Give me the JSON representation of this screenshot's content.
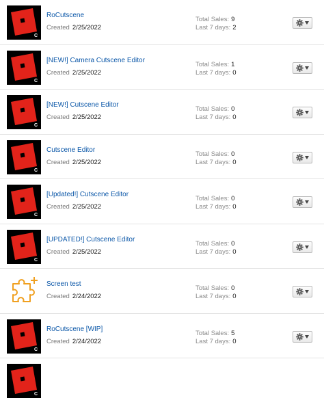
{
  "labels": {
    "created": "Created",
    "total_sales": "Total Sales:",
    "last_7_days": "Last 7 days:"
  },
  "icons": {
    "thumbnail": "roblox-studio-logo-icon",
    "plugin": "puzzle-piece-plus-icon",
    "settings": "gear-icon",
    "dropdown": "caret-down-icon"
  },
  "colors": {
    "title_link": "#0b57a8",
    "roblox_red": "#e2231a",
    "plugin_orange": "#f0a020"
  },
  "items": [
    {
      "title": "RoCutscene",
      "created": "2/25/2022",
      "total_sales": "9",
      "last_7_days": "2"
    },
    {
      "title": "[NEW!] Camera Cutscene Editor",
      "created": "2/25/2022",
      "total_sales": "1",
      "last_7_days": "0"
    },
    {
      "title": "[NEW!] Cutscene Editor",
      "created": "2/25/2022",
      "total_sales": "0",
      "last_7_days": "0"
    },
    {
      "title": "Cutscene Editor",
      "created": "2/25/2022",
      "total_sales": "0",
      "last_7_days": "0"
    },
    {
      "title": "[Updated!] Cutscene Editor",
      "created": "2/25/2022",
      "total_sales": "0",
      "last_7_days": "0"
    },
    {
      "title": "[UPDATED!] Cutscene Editor",
      "created": "2/25/2022",
      "total_sales": "0",
      "last_7_days": "0"
    },
    {
      "title": "Screen test",
      "created": "2/24/2022",
      "total_sales": "0",
      "last_7_days": "0"
    },
    {
      "title": "RoCutscene [WIP]",
      "created": "2/24/2022",
      "total_sales": "5",
      "last_7_days": "0"
    }
  ]
}
